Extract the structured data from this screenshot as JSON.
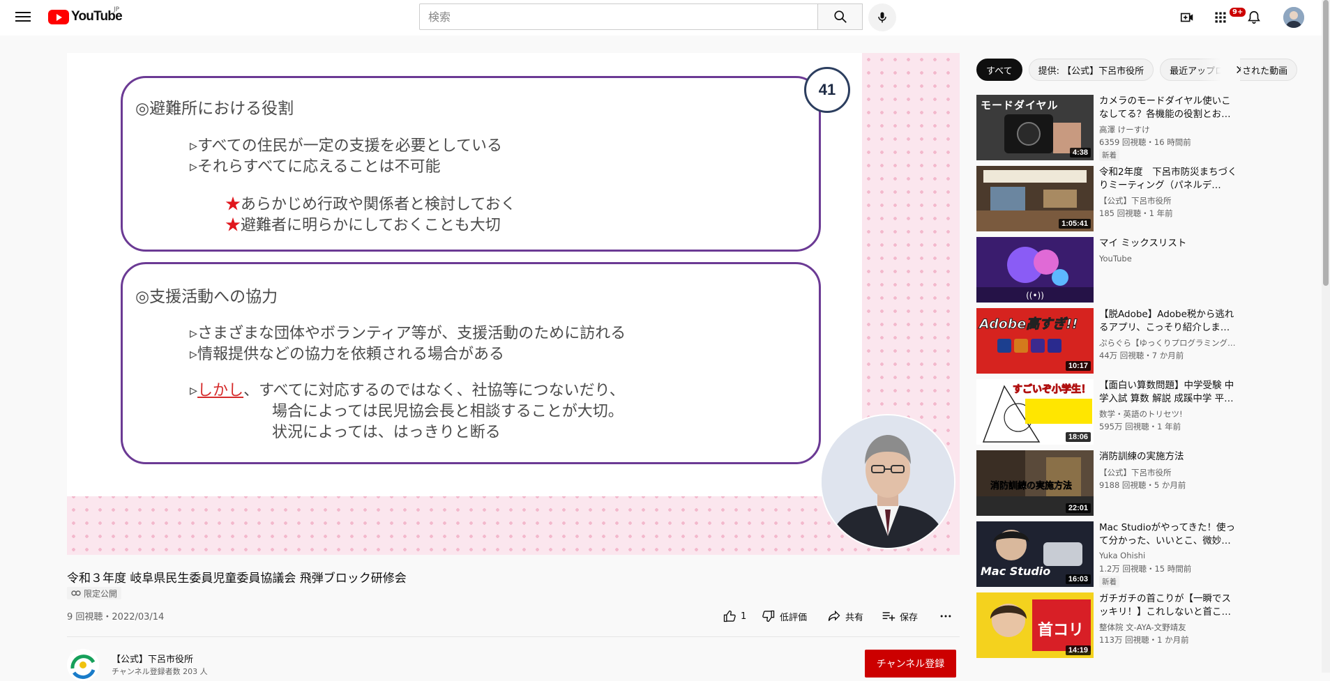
{
  "masthead": {
    "logo_text": "YouTube",
    "country_code": "JP",
    "search_placeholder": "検索",
    "notification_count": "9+"
  },
  "slide": {
    "number": "41",
    "box1_heading": "◎避難所における役割",
    "box1_lines": [
      "▹すべての住民が一定の支援を必要としている",
      "▹それらすべてに応えることは不可能"
    ],
    "box1_star_lines": [
      "あらかじめ行政や関係者と検討しておく",
      "避難者に明らかにしておくことも大切"
    ],
    "star_glyph": "★",
    "box2_heading": "◎支援活動への協力",
    "box2_lines": [
      "▹さまざまな団体やボランティア等が、支援活動のために訪れる",
      "▹情報提供などの協力を依頼される場合がある"
    ],
    "box2_however_prefix": "▹",
    "box2_however_word": "しかし",
    "box2_however_rest": "、すべてに対応するのではなく、社協等につないだり、",
    "box2_tail_lines": [
      "場合によっては民児協会長と相談することが大切。",
      "状況によっては、はっきりと断る"
    ]
  },
  "video": {
    "title": "令和３年度 岐阜県民生委員児童委員協議会 飛弾ブロック研修会",
    "visibility_badge": "限定公開",
    "views_date": "9 回視聴・2022/03/14",
    "like_count": "1",
    "dislike_label": "低評価",
    "share_label": "共有",
    "save_label": "保存"
  },
  "channel": {
    "name": "【公式】下呂市役所",
    "subscribers": "チャンネル登録者数 203 人",
    "subscribe_label": "チャンネル登録"
  },
  "sidebar": {
    "chips": [
      "すべて",
      "提供: 【公式】下呂市役所",
      "最近アップロードされた動画"
    ],
    "recommendations": [
      {
        "title": "カメラのモードダイヤル使いこなしてる？各機能の役割とお…",
        "channel": "高澤 けーすけ",
        "meta": "6359 回視聴・16 時間前",
        "duration": "4:38",
        "badge": "新着",
        "thumb_text": "モードダイヤル"
      },
      {
        "title": "令和2年度　下呂市防災まちづくりミーティング（パネルデ…",
        "channel": "【公式】下呂市役所",
        "meta": "185 回視聴・1 年前",
        "duration": "1:05:41",
        "badge": "",
        "thumb_text": ""
      },
      {
        "title": "マイ ミックスリスト",
        "channel": "YouTube",
        "meta": "",
        "duration": "",
        "badge": "",
        "thumb_text": "((•))"
      },
      {
        "title": "【脱Adobe】Adobe税から逃れるアプリ、こっそり紹介しま…",
        "channel": "ぷらぐら【ゆっくりプログラミング…",
        "meta": "44万 回視聴・7 か月前",
        "duration": "10:17",
        "badge": "",
        "thumb_text": "Adobe高すぎ!!"
      },
      {
        "title": "【面白い算数問題】中学受験 中学入試 算数 解説 成蹊中学 平…",
        "channel": "数学・英語のトリセツ!",
        "meta": "595万 回視聴・1 年前",
        "duration": "18:06",
        "badge": "",
        "thumb_text": "すごいぞ小学生！"
      },
      {
        "title": "消防訓練の実施方法",
        "channel": "【公式】下呂市役所",
        "meta": "9188 回視聴・5 か月前",
        "duration": "22:01",
        "badge": "",
        "thumb_text": "消防訓練の実施方法"
      },
      {
        "title": "Mac Studioがやってきた！使って分かった、いいとこ、微妙…",
        "channel": "Yuka Ohishi",
        "meta": "1.2万 回視聴・15 時間前",
        "duration": "16:03",
        "badge": "新着",
        "thumb_text": "Mac Studio"
      },
      {
        "title": "ガチガチの首こりが【一瞬でスッキリ！】これしないと首こ…",
        "channel": "整体院 文-AYA-文野靖友",
        "meta": "113万 回視聴・1 か月前",
        "duration": "14:19",
        "badge": "",
        "thumb_text": "首コリ"
      }
    ]
  }
}
